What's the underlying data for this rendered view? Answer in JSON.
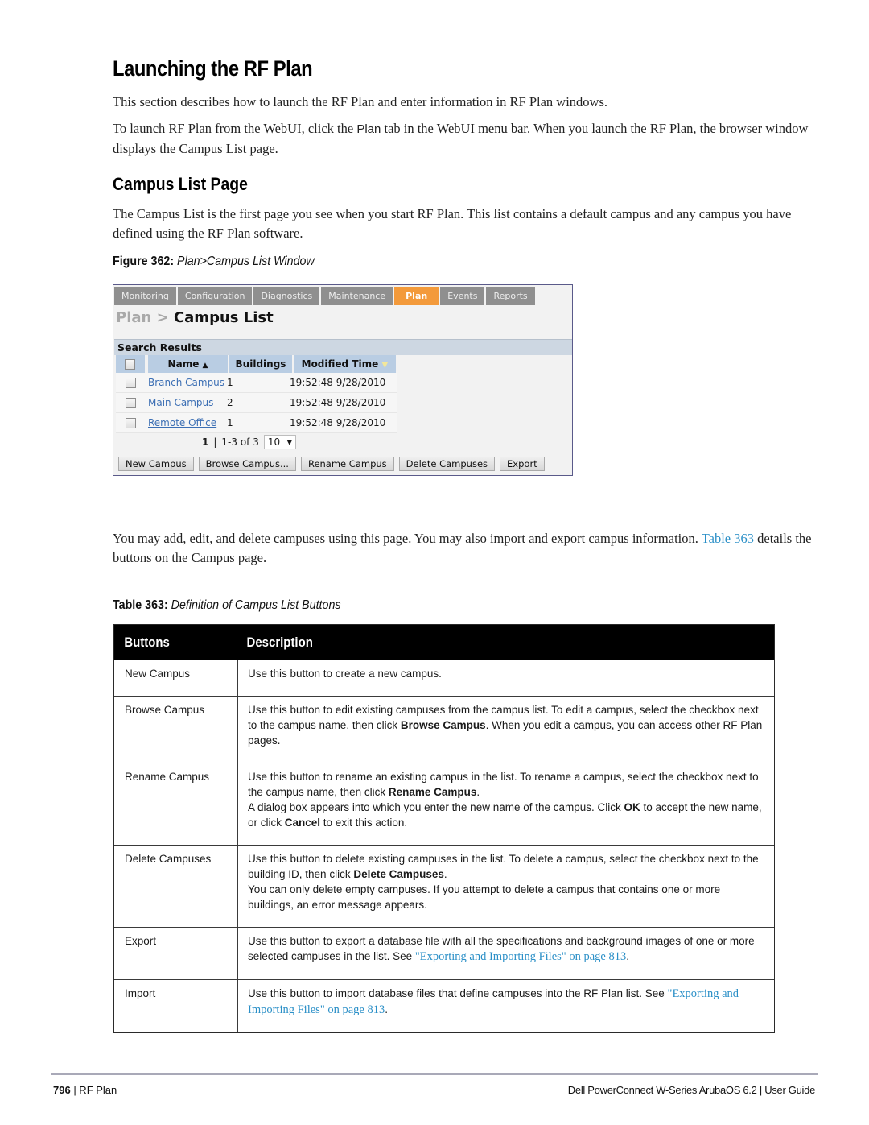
{
  "heading1": "Launching the RF Plan",
  "intro": {
    "p1": "This section describes how to launch the RF Plan and enter information in RF Plan windows.",
    "p2_before": "To launch RF Plan from the WebUI, click the ",
    "p2_bold": "Plan",
    "p2_after": " tab in the WebUI menu bar. When you launch the RF Plan, the browser window displays the Campus List page."
  },
  "heading2": "Campus List Page",
  "campus_intro": "The Campus List is the first page you see when you start RF Plan. This list contains a default campus and any campus you have defined using the RF Plan software.",
  "figure_caption": {
    "label": "Figure 362:",
    "title": "Plan>Campus List Window"
  },
  "figure": {
    "tabs": [
      {
        "label": "Monitoring",
        "active": false
      },
      {
        "label": "Configuration",
        "active": false
      },
      {
        "label": "Diagnostics",
        "active": false
      },
      {
        "label": "Maintenance",
        "active": false
      },
      {
        "label": "Plan",
        "active": true
      },
      {
        "label": "Events",
        "active": false
      },
      {
        "label": "Reports",
        "active": false
      }
    ],
    "breadcrumb_prefix": "Plan > ",
    "breadcrumb_current": "Campus List",
    "search_results_label": "Search Results",
    "columns": {
      "name": "Name",
      "name_sort": "▲",
      "buildings": "Buildings",
      "modified": "Modified Time",
      "modified_sort": "▼"
    },
    "rows": [
      {
        "name": "Branch Campus",
        "buildings": "1",
        "modified": "19:52:48 9/28/2010"
      },
      {
        "name": "Main Campus",
        "buildings": "2",
        "modified": "19:52:48 9/28/2010"
      },
      {
        "name": "Remote Office",
        "buildings": "1",
        "modified": "19:52:48 9/28/2010"
      }
    ],
    "pager": {
      "page": "1",
      "separator": "|",
      "range": "1-3 of 3",
      "page_size": "10",
      "caret": "▼"
    },
    "buttons": [
      "New Campus",
      "Browse Campus...",
      "Rename Campus",
      "Delete Campuses",
      "Export"
    ],
    "colors": {
      "active_tab": "#f39a3b",
      "tab": "#8f8f8f",
      "header_cell": "#b9cde3",
      "link": "#3c6fb4"
    }
  },
  "after_figure": {
    "text_before": "You may add, edit, and delete campuses using this page. You may also import and export campus information. ",
    "link": "Table 363",
    "text_after": " details the buttons on the Campus page."
  },
  "table_caption": {
    "label": "Table 363:",
    "title": "Definition of Campus List Buttons"
  },
  "table": {
    "headers": [
      "Buttons",
      "Description"
    ],
    "rows": [
      {
        "button": "New Campus",
        "desc": [
          {
            "t": "Use this button to create a new campus."
          }
        ]
      },
      {
        "button": "Browse Campus",
        "desc": [
          {
            "t": "Use this button to edit existing campuses from the campus list. To edit a campus, select the checkbox next to the campus name, then click "
          },
          {
            "b": "Browse Campus"
          },
          {
            "t": ". When you edit a campus, you can access other RF Plan pages."
          }
        ]
      },
      {
        "button": "Rename Campus",
        "desc": [
          {
            "t": "Use this button to rename an existing campus in the list. To rename a campus, select the checkbox next to the campus name, then click "
          },
          {
            "b": "Rename Campus"
          },
          {
            "t": "."
          },
          {
            "br": true
          },
          {
            "t": "A dialog box appears into which you enter the new name of the campus. Click "
          },
          {
            "b": "OK"
          },
          {
            "t": " to accept the new name, or click "
          },
          {
            "b": "Cancel"
          },
          {
            "t": " to exit this action."
          }
        ]
      },
      {
        "button": "Delete Campuses",
        "desc": [
          {
            "t": "Use this button to delete existing campuses in the list. To delete a campus, select the checkbox next to the building ID, then click "
          },
          {
            "b": "Delete Campuses"
          },
          {
            "t": "."
          },
          {
            "br": true
          },
          {
            "t": "You can only delete empty campuses. If you attempt to delete a campus that contains one or more buildings, an error message appears."
          }
        ]
      },
      {
        "button": "Export",
        "desc": [
          {
            "t": "Use this button to export a database file with all the specifications and background images of one or more selected campuses in the list. See "
          },
          {
            "link": "\"Exporting and Importing Files\" on page 813"
          },
          {
            "t": "."
          }
        ]
      },
      {
        "button": "Import",
        "desc": [
          {
            "t": "Use this button to import database files that define campuses into the RF Plan list. See "
          },
          {
            "link": "\"Exporting and Importing Files\" on page 813"
          },
          {
            "t": "."
          }
        ]
      }
    ]
  },
  "footer": {
    "page_number": "796",
    "section": " | RF Plan",
    "guide_title": "Dell PowerConnect W-Series ArubaOS 6.2  |  User Guide"
  },
  "colors": {
    "link": "#2a8fc7",
    "table_header_bg": "#000000",
    "footer_rule": "#a9a9b8"
  }
}
